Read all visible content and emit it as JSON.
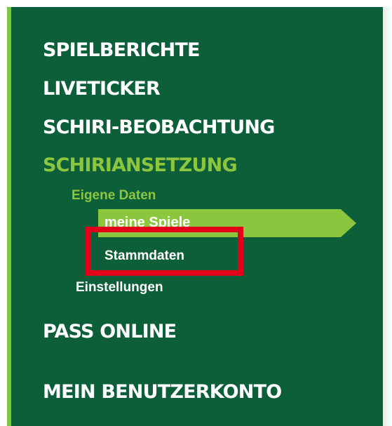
{
  "menu": {
    "top_items": [
      {
        "label": "SPIELBERICHTE",
        "active": false
      },
      {
        "label": "LIVETICKER",
        "active": false
      },
      {
        "label": "SCHIRI-BEOBACHTUNG",
        "active": false
      },
      {
        "label": "SCHIRIANSETZUNG",
        "active": true
      },
      {
        "label": "PASS ONLINE",
        "active": false
      },
      {
        "label": "MEIN BENUTZERKONTO",
        "active": false
      }
    ],
    "submenu": {
      "heading": "Eigene Daten",
      "selected_item": "meine Spiele",
      "highlighted_item": "Stammdaten",
      "settings_item": "Einstellungen"
    }
  },
  "colors": {
    "panel_bg": "#0d5f3a",
    "accent_green": "#8cc63f",
    "highlight_red": "#e3001b",
    "text_white": "#ffffff"
  }
}
